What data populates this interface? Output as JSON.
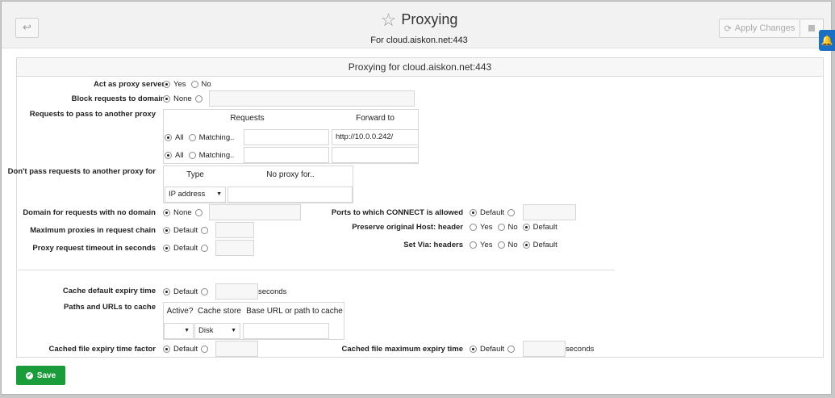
{
  "header": {
    "back_glyph": "↩",
    "title": "Proxying",
    "subtitle": "For cloud.aiskon.net:443",
    "apply_label": "Apply Changes"
  },
  "panel": {
    "heading": "Proxying for cloud.aiskon.net:443",
    "proxy_server": {
      "label": "Act as proxy server?",
      "yes": "Yes",
      "no": "No",
      "selected": "Yes"
    },
    "block_domains": {
      "label": "Block requests to domains",
      "none": "None"
    },
    "pass_proxy": {
      "label": "Requests to pass to another proxy",
      "col_requests": "Requests",
      "col_forward": "Forward to",
      "rows": [
        {
          "all": "All",
          "matching": "Matching..",
          "forward": "http://10.0.0.242/"
        },
        {
          "all": "All",
          "matching": "Matching..",
          "forward": ""
        }
      ]
    },
    "no_pass": {
      "label": "Don't pass requests to another proxy for",
      "col_type": "Type",
      "col_noproxy": "No proxy for..",
      "type_value": "IP address"
    },
    "no_domain": {
      "label": "Domain for requests with no domain",
      "none": "None"
    },
    "connect": {
      "label": "Ports to which CONNECT is allowed",
      "default": "Default"
    },
    "max_proxies": {
      "label": "Maximum proxies in request chain",
      "default": "Default"
    },
    "preserve_host": {
      "label": "Preserve original Host: header",
      "yes": "Yes",
      "no": "No",
      "default": "Default"
    },
    "timeout": {
      "label": "Proxy request timeout in seconds",
      "default": "Default"
    },
    "set_via": {
      "label": "Set Via: headers",
      "yes": "Yes",
      "no": "No",
      "default": "Default"
    },
    "cache_expiry": {
      "label": "Cache default expiry time",
      "default": "Default",
      "unit": "seconds"
    },
    "cache_paths": {
      "label": "Paths and URLs to cache",
      "col_active": "Active?",
      "col_store": "Cache store",
      "col_base": "Base URL or path to cache",
      "store_value": "Disk"
    },
    "cached_factor": {
      "label": "Cached file expiry time factor",
      "default": "Default"
    },
    "cached_max": {
      "label": "Cached file maximum expiry time",
      "default": "Default",
      "unit": "seconds"
    }
  },
  "save_label": "Save"
}
